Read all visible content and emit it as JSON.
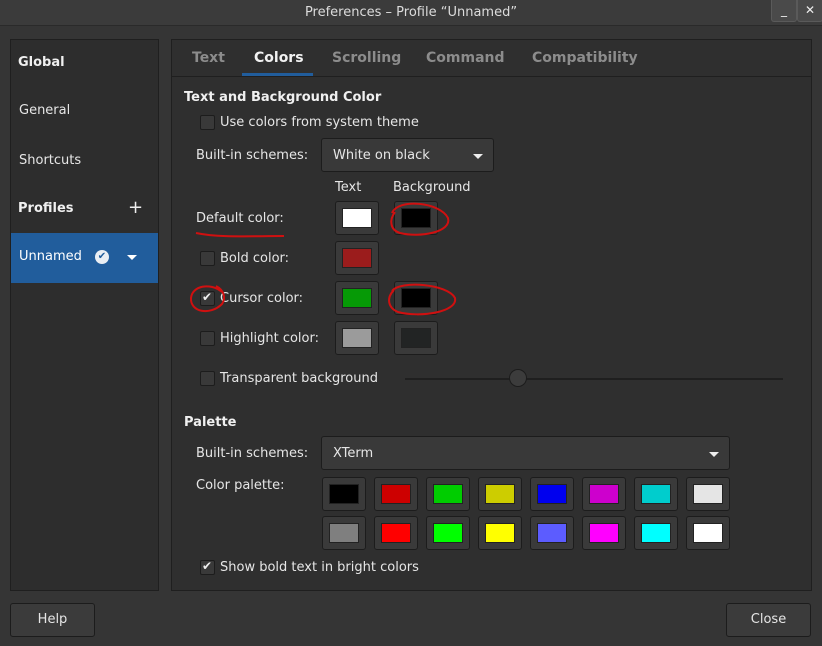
{
  "window": {
    "title": "Preferences – Profile “Unnamed”",
    "minimize_label": "_",
    "close_label": "✕"
  },
  "sidebar": {
    "global_heading": "Global",
    "general": "General",
    "shortcuts": "Shortcuts",
    "profiles_heading": "Profiles",
    "add_label": "+",
    "profile_name": "Unnamed",
    "default_badge": "✔"
  },
  "tabs": [
    "Text",
    "Colors",
    "Scrolling",
    "Command",
    "Compatibility"
  ],
  "active_tab": "Colors",
  "text_bg": {
    "heading": "Text and Background Color",
    "use_system": "Use colors from system theme",
    "use_system_checked": false,
    "builtin_label": "Built-in schemes:",
    "builtin_value": "White on black",
    "col_text": "Text",
    "col_background": "Background",
    "default_color": "Default color:",
    "default_text_color": "#ffffff",
    "default_bg_color": "#000000",
    "bold_color": "Bold color:",
    "bold_checked": false,
    "bold_text_color": "#9b1c1c",
    "cursor_color": "Cursor color:",
    "cursor_checked": true,
    "cursor_text_color": "#069a06",
    "cursor_bg_color": "#000000",
    "highlight_color": "Highlight color:",
    "highlight_checked": false,
    "highlight_text_color": "#9b9b9b",
    "highlight_bg_color": "#222424",
    "transparent": "Transparent background",
    "transparent_checked": false
  },
  "palette": {
    "heading": "Palette",
    "builtin_label": "Built-in schemes:",
    "builtin_value": "XTerm",
    "color_palette_label": "Color palette:",
    "row1": [
      "#000000",
      "#cd0000",
      "#00cd00",
      "#cdcd00",
      "#0000ee",
      "#cd00cd",
      "#00cdcd",
      "#e5e5e5"
    ],
    "row2": [
      "#7f7f7f",
      "#ff0000",
      "#00ff00",
      "#ffff00",
      "#5c5cff",
      "#ff00ff",
      "#00ffff",
      "#ffffff"
    ],
    "bold_bright": "Show bold text in bright colors",
    "bold_bright_checked": true
  },
  "buttons": {
    "help": "Help",
    "close": "Close"
  },
  "annotation_color": "#d01010"
}
